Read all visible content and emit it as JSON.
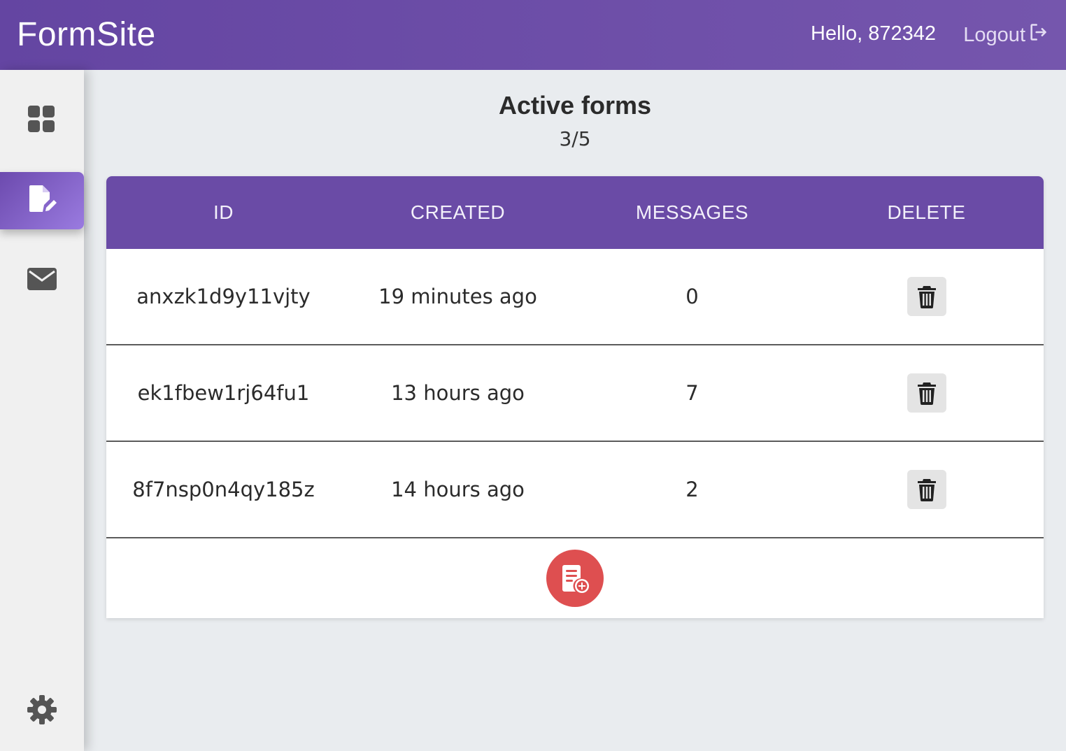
{
  "header": {
    "brand": "FormSite",
    "greeting": "Hello, 872342",
    "logout_label": "Logout"
  },
  "sidebar": {
    "items": [
      {
        "name": "dashboard",
        "icon": "grid-icon",
        "active": false
      },
      {
        "name": "forms",
        "icon": "edit-document-icon",
        "active": true
      },
      {
        "name": "messages",
        "icon": "envelope-icon",
        "active": false
      },
      {
        "name": "settings",
        "icon": "gear-icon",
        "active": false
      }
    ]
  },
  "main": {
    "title": "Active forms",
    "count": "3/5",
    "table": {
      "headers": [
        "ID",
        "CREATED",
        "MESSAGES",
        "DELETE"
      ],
      "rows": [
        {
          "id": "anxzk1d9y11vjty",
          "created": "19 minutes ago",
          "messages": "0"
        },
        {
          "id": "ek1fbew1rj64fu1",
          "created": "13 hours ago",
          "messages": "7"
        },
        {
          "id": "8f7nsp0n4qy185z",
          "created": "14 hours ago",
          "messages": "2"
        }
      ]
    }
  },
  "colors": {
    "header_bg": "#6445a2",
    "table_header_bg": "#6a4ba6",
    "add_button": "#de4f50",
    "active_sidebar": "#7c5cc4"
  }
}
